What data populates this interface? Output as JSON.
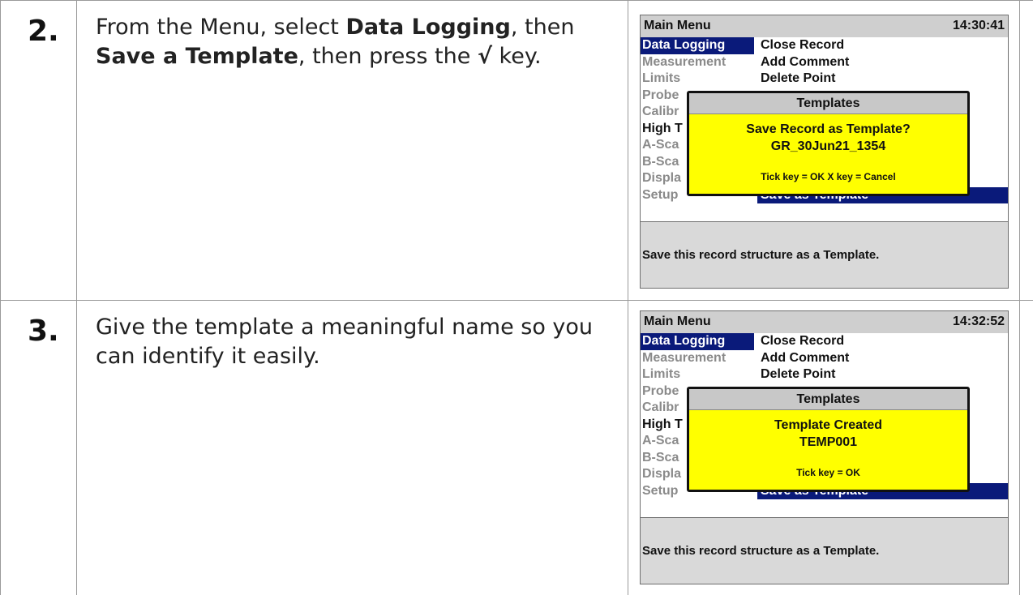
{
  "steps": [
    {
      "number": "2.",
      "text": {
        "p1": "From the Menu, select ",
        "b1": "Data Logging",
        "p2": ", then ",
        "b2": "Save a Template",
        "p3": ", then press the ",
        "b3": "√",
        "p4": " key."
      },
      "screen": {
        "title": "Main Menu",
        "time": "14:30:41",
        "left_menu": [
          "Data Logging",
          "Measurement",
          "Limits",
          "Probe",
          "Calibr",
          "High T",
          "A-Sca",
          "B-Sca",
          "Displa",
          "Setup"
        ],
        "right_menu": [
          "Close Record",
          "Add Comment",
          "Delete Point",
          "Save as Template"
        ],
        "popup_title": "Templates",
        "popup_line1": "Save Record as Template?",
        "popup_line2": "GR_30Jun21_1354",
        "popup_hint": "Tick key = OK  X key = Cancel",
        "status": "Save this record structure as a Template."
      }
    },
    {
      "number": "3.",
      "text": {
        "p1": "Give the template a meaningful name so you can identify it easily."
      },
      "screen": {
        "title": "Main Menu",
        "time": "14:32:52",
        "left_menu": [
          "Data Logging",
          "Measurement",
          "Limits",
          "Probe",
          "Calibr",
          "High T",
          "A-Sca",
          "B-Sca",
          "Displa",
          "Setup"
        ],
        "right_menu": [
          "Close Record",
          "Add Comment",
          "Delete Point",
          "Save as Template"
        ],
        "popup_title": "Templates",
        "popup_line1": "Template Created",
        "popup_line2": "TEMP001",
        "popup_hint": "Tick key = OK",
        "status": "Save this record structure as a Template."
      }
    }
  ],
  "colors": {
    "selection": "#0a1a7a",
    "popup": "#ffff00",
    "title_bar": "#cfcfcf",
    "status_bar": "#d9d9d9"
  }
}
